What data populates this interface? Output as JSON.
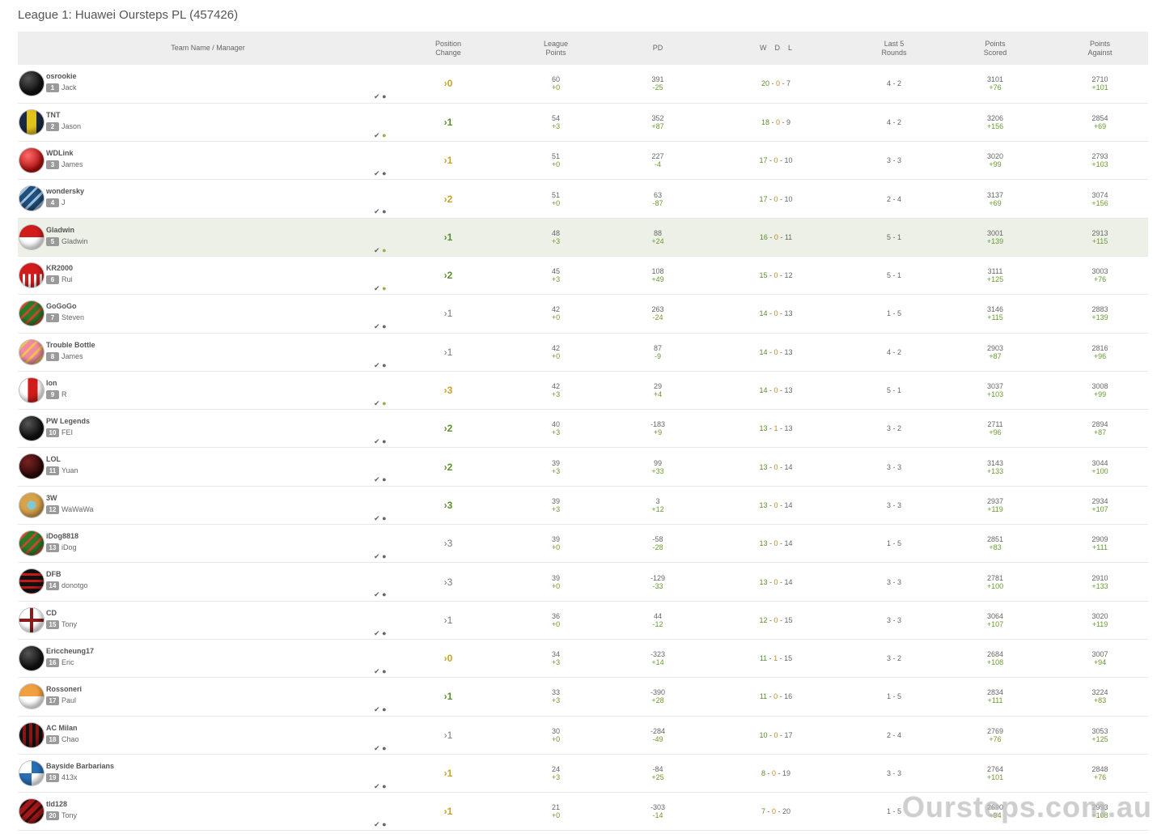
{
  "title": "League 1: Huawei Oursteps PL (457426)",
  "headers": {
    "team": "Team Name / Manager",
    "position_change": [
      "Position",
      "Change"
    ],
    "league_points": [
      "League",
      "Points"
    ],
    "pd": "PD",
    "wdl": [
      "W",
      "D",
      "L"
    ],
    "last5": [
      "Last 5",
      "Rounds"
    ],
    "points_scored": [
      "Points",
      "Scored"
    ],
    "points_against": [
      "Points",
      "Against"
    ]
  },
  "rows": [
    {
      "team": "osrookie",
      "rank": "1",
      "manager": "Jack",
      "pc": "0",
      "pc_dir": "flat",
      "lp": "60",
      "lp_delta": "+0",
      "pd": "391",
      "pd_delta": "-25",
      "w": "20",
      "d": "0",
      "l": "7",
      "last5": "4 - 2",
      "ps": "3101",
      "ps_delta": "+76",
      "pa": "2710",
      "pa_delta": "+101",
      "user_green": false,
      "avatar": "black"
    },
    {
      "team": "TNT",
      "rank": "2",
      "manager": "Jason",
      "pc": "1",
      "pc_dir": "up",
      "lp": "54",
      "lp_delta": "+3",
      "pd": "352",
      "pd_delta": "+87",
      "w": "18",
      "d": "0",
      "l": "9",
      "last5": "4 - 2",
      "ps": "3206",
      "ps_delta": "+156",
      "pa": "2854",
      "pa_delta": "+69",
      "user_green": true,
      "avatar": "tnt"
    },
    {
      "team": "WDLink",
      "rank": "3",
      "manager": "James",
      "pc": "1",
      "pc_dir": "flat",
      "lp": "51",
      "lp_delta": "+0",
      "pd": "227",
      "pd_delta": "-4",
      "w": "17",
      "d": "0",
      "l": "10",
      "last5": "3 - 3",
      "ps": "3020",
      "ps_delta": "+99",
      "pa": "2793",
      "pa_delta": "+103",
      "user_green": false,
      "avatar": "red"
    },
    {
      "team": "wondersky",
      "rank": "4",
      "manager": "J",
      "pc": "2",
      "pc_dir": "flat",
      "lp": "51",
      "lp_delta": "+0",
      "pd": "63",
      "pd_delta": "-87",
      "w": "17",
      "d": "0",
      "l": "10",
      "last5": "2 - 4",
      "ps": "3137",
      "ps_delta": "+69",
      "pa": "3074",
      "pa_delta": "+156",
      "user_green": false,
      "avatar": "chevron-blue"
    },
    {
      "team": "Gladwin",
      "rank": "5",
      "manager": "Gladwin",
      "pc": "1",
      "pc_dir": "up",
      "lp": "48",
      "lp_delta": "+3",
      "pd": "88",
      "pd_delta": "+24",
      "w": "16",
      "d": "0",
      "l": "11",
      "last5": "5 - 1",
      "ps": "3001",
      "ps_delta": "+139",
      "pa": "2913",
      "pa_delta": "+115",
      "user_green": true,
      "avatar": "redwhite",
      "highlight": true
    },
    {
      "team": "KR2000",
      "rank": "6",
      "manager": "Rui",
      "pc": "2",
      "pc_dir": "up",
      "lp": "45",
      "lp_delta": "+3",
      "pd": "108",
      "pd_delta": "+49",
      "w": "15",
      "d": "0",
      "l": "12",
      "last5": "5 - 1",
      "ps": "3111",
      "ps_delta": "+125",
      "pa": "3003",
      "pa_delta": "+76",
      "user_green": true,
      "avatar": "redstripes"
    },
    {
      "team": "GoGoGo",
      "rank": "7",
      "manager": "Steven",
      "pc": "1",
      "pc_dir": "down",
      "lp": "42",
      "lp_delta": "+0",
      "pd": "263",
      "pd_delta": "-24",
      "w": "14",
      "d": "0",
      "l": "13",
      "last5": "1 - 5",
      "ps": "3146",
      "ps_delta": "+115",
      "pa": "2883",
      "pa_delta": "+139",
      "user_green": false,
      "avatar": "chevron-green"
    },
    {
      "team": "Trouble Bottle",
      "rank": "8",
      "manager": "James",
      "pc": "1",
      "pc_dir": "down",
      "lp": "42",
      "lp_delta": "+0",
      "pd": "87",
      "pd_delta": "-9",
      "w": "14",
      "d": "0",
      "l": "13",
      "last5": "4 - 2",
      "ps": "2903",
      "ps_delta": "+87",
      "pa": "2816",
      "pa_delta": "+96",
      "user_green": false,
      "avatar": "chevron-pink"
    },
    {
      "team": "lon",
      "rank": "9",
      "manager": "R",
      "pc": "3",
      "pc_dir": "flat",
      "lp": "42",
      "lp_delta": "+3",
      "pd": "29",
      "pd_delta": "+4",
      "w": "14",
      "d": "0",
      "l": "13",
      "last5": "5 - 1",
      "ps": "3037",
      "ps_delta": "+103",
      "pa": "3008",
      "pa_delta": "+99",
      "user_green": true,
      "avatar": "redbar"
    },
    {
      "team": "PW Legends",
      "rank": "10",
      "manager": "FEI",
      "pc": "2",
      "pc_dir": "up",
      "lp": "40",
      "lp_delta": "+3",
      "pd": "-183",
      "pd_delta": "+9",
      "w": "13",
      "d": "1",
      "l": "13",
      "last5": "3 - 2",
      "ps": "2711",
      "ps_delta": "+96",
      "pa": "2894",
      "pa_delta": "+87",
      "user_green": false,
      "avatar": "black"
    },
    {
      "team": "LOL",
      "rank": "11",
      "manager": "Yuan",
      "pc": "2",
      "pc_dir": "up",
      "lp": "39",
      "lp_delta": "+3",
      "pd": "99",
      "pd_delta": "+33",
      "w": "13",
      "d": "0",
      "l": "14",
      "last5": "3 - 3",
      "ps": "3143",
      "ps_delta": "+133",
      "pa": "3044",
      "pa_delta": "+100",
      "user_green": false,
      "avatar": "darkred"
    },
    {
      "team": "3W",
      "rank": "12",
      "manager": "WaWaWa",
      "pc": "3",
      "pc_dir": "up",
      "lp": "39",
      "lp_delta": "+3",
      "pd": "3",
      "pd_delta": "+12",
      "w": "13",
      "d": "0",
      "l": "14",
      "last5": "3 - 3",
      "ps": "2937",
      "ps_delta": "+119",
      "pa": "2934",
      "pa_delta": "+107",
      "user_green": false,
      "avatar": "star"
    },
    {
      "team": "iDog8818",
      "rank": "13",
      "manager": "iDog",
      "pc": "3",
      "pc_dir": "down",
      "lp": "39",
      "lp_delta": "+0",
      "pd": "-58",
      "pd_delta": "-28",
      "w": "13",
      "d": "0",
      "l": "14",
      "last5": "1 - 5",
      "ps": "2851",
      "ps_delta": "+83",
      "pa": "2909",
      "pa_delta": "+111",
      "user_green": false,
      "avatar": "chevron-green"
    },
    {
      "team": "DFB",
      "rank": "14",
      "manager": "donotgo",
      "pc": "3",
      "pc_dir": "down",
      "lp": "39",
      "lp_delta": "+0",
      "pd": "-129",
      "pd_delta": "-33",
      "w": "13",
      "d": "0",
      "l": "14",
      "last5": "3 - 3",
      "ps": "2781",
      "ps_delta": "+100",
      "pa": "2910",
      "pa_delta": "+133",
      "user_green": false,
      "avatar": "hoops"
    },
    {
      "team": "CD",
      "rank": "15",
      "manager": "Tony",
      "pc": "1",
      "pc_dir": "down",
      "lp": "36",
      "lp_delta": "+0",
      "pd": "44",
      "pd_delta": "-12",
      "w": "12",
      "d": "0",
      "l": "15",
      "last5": "3 - 3",
      "ps": "3064",
      "ps_delta": "+107",
      "pa": "3020",
      "pa_delta": "+119",
      "user_green": false,
      "avatar": "cross"
    },
    {
      "team": "Ericcheung17",
      "rank": "16",
      "manager": "Eric",
      "pc": "0",
      "pc_dir": "flat",
      "lp": "34",
      "lp_delta": "+3",
      "pd": "-323",
      "pd_delta": "+14",
      "w": "11",
      "d": "1",
      "l": "15",
      "last5": "3 - 2",
      "ps": "2684",
      "ps_delta": "+108",
      "pa": "3007",
      "pa_delta": "+94",
      "user_green": false,
      "avatar": "black"
    },
    {
      "team": "Rossoneri",
      "rank": "17",
      "manager": "Paul",
      "pc": "1",
      "pc_dir": "up",
      "lp": "33",
      "lp_delta": "+3",
      "pd": "-390",
      "pd_delta": "+28",
      "w": "11",
      "d": "0",
      "l": "16",
      "last5": "1 - 5",
      "ps": "2834",
      "ps_delta": "+111",
      "pa": "3224",
      "pa_delta": "+83",
      "user_green": false,
      "avatar": "orangewhite"
    },
    {
      "team": "AC Milan",
      "rank": "18",
      "manager": "Chao",
      "pc": "1",
      "pc_dir": "down",
      "lp": "30",
      "lp_delta": "+0",
      "pd": "-284",
      "pd_delta": "-49",
      "w": "10",
      "d": "0",
      "l": "17",
      "last5": "2 - 4",
      "ps": "2769",
      "ps_delta": "+76",
      "pa": "3053",
      "pa_delta": "+125",
      "user_green": false,
      "avatar": "milan"
    },
    {
      "team": "Bayside Barbarians",
      "rank": "19",
      "manager": "413x",
      "pc": "1",
      "pc_dir": "flat",
      "lp": "24",
      "lp_delta": "+3",
      "pd": "-84",
      "pd_delta": "+25",
      "w": "8",
      "d": "0",
      "l": "19",
      "last5": "3 - 3",
      "ps": "2764",
      "ps_delta": "+101",
      "pa": "2848",
      "pa_delta": "+76",
      "user_green": false,
      "avatar": "quarters"
    },
    {
      "team": "tld128",
      "rank": "20",
      "manager": "Tony",
      "pc": "1",
      "pc_dir": "flat",
      "lp": "21",
      "lp_delta": "+0",
      "pd": "-303",
      "pd_delta": "-14",
      "w": "7",
      "d": "0",
      "l": "20",
      "last5": "1 - 5",
      "ps": "2690",
      "ps_delta": "+94",
      "pa": "2993",
      "pa_delta": "+108",
      "user_green": false,
      "avatar": "chevron-red"
    }
  ],
  "watermark": "Oursteps.com.au",
  "colors": {
    "positive": "#5b8d2a",
    "neutral": "#c9a227",
    "highlight_row": "#edf0e6",
    "header_bg": "#eeeeee"
  },
  "icons": {
    "check": "check-icon",
    "user": "user-icon",
    "position": "chevron-right-icon"
  }
}
